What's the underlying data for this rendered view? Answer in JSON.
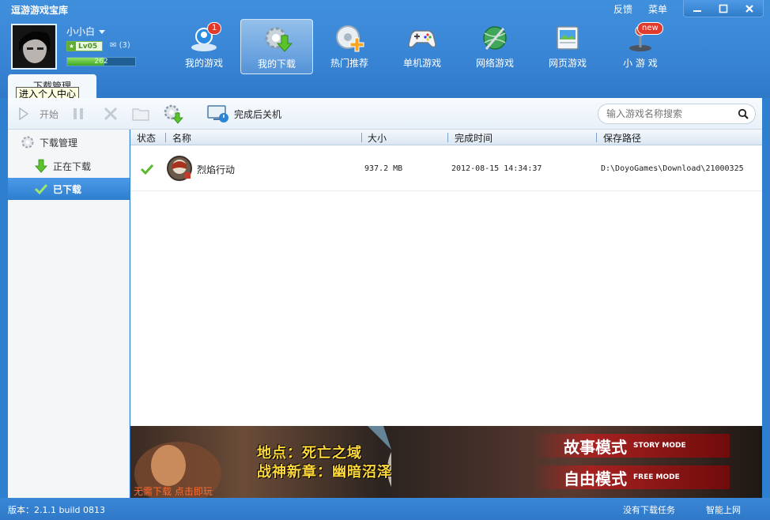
{
  "app": {
    "title": "逗游游戏宝库",
    "feedback": "反馈",
    "menu": "菜单"
  },
  "user": {
    "name": "小小白",
    "level": "Lv05",
    "mail_count": "(3)",
    "exp_value": "262",
    "exp_progress": 0.55,
    "tooltip": "进入个人中心"
  },
  "nav": [
    {
      "label": "我的游戏",
      "icon": "my-games-icon",
      "badge": "1"
    },
    {
      "label": "我的下载",
      "icon": "my-downloads-icon",
      "active": true
    },
    {
      "label": "热门推荐",
      "icon": "hot-recommend-icon"
    },
    {
      "label": "单机游戏",
      "icon": "gamepad-icon"
    },
    {
      "label": "网络游戏",
      "icon": "online-games-icon"
    },
    {
      "label": "网页游戏",
      "icon": "web-games-icon"
    },
    {
      "label": "小 游 戏",
      "icon": "joystick-icon",
      "badge": "new"
    }
  ],
  "tab": {
    "label": "下载管理"
  },
  "toolbar": {
    "start": "开始",
    "shutdown": "完成后关机",
    "search_placeholder": "输入游戏名称搜索"
  },
  "sidebar": {
    "header": "下载管理",
    "items": [
      {
        "label": "正在下载"
      },
      {
        "label": "已下载",
        "selected": true
      }
    ]
  },
  "table": {
    "columns": [
      "状态",
      "名称",
      "大小",
      "完成时间",
      "保存路径"
    ],
    "rows": [
      {
        "status": "completed",
        "name": "烈焰行动",
        "size": "937.2 MB",
        "time": "2012-08-15 14:34:37",
        "path": "D:\\DoyoGames\\Download\\21000325"
      }
    ]
  },
  "banner": {
    "line1": "地点：死亡之域",
    "line2": "战神新章：幽暗沼泽",
    "mode1_cn": "故事模式",
    "mode1_en": "STORY MODE",
    "mode2_cn": "自由模式",
    "mode2_en": "FREE MODE",
    "bottom": "无需下载 点击即玩"
  },
  "status": {
    "version": "版本：2.1.1 build 0813",
    "tasks": "没有下载任务",
    "network": "智能上网"
  },
  "colors": {
    "header_blue": "#3a86d6",
    "selected_blue": "#2f7fd0",
    "check_green": "#5cb82f"
  }
}
